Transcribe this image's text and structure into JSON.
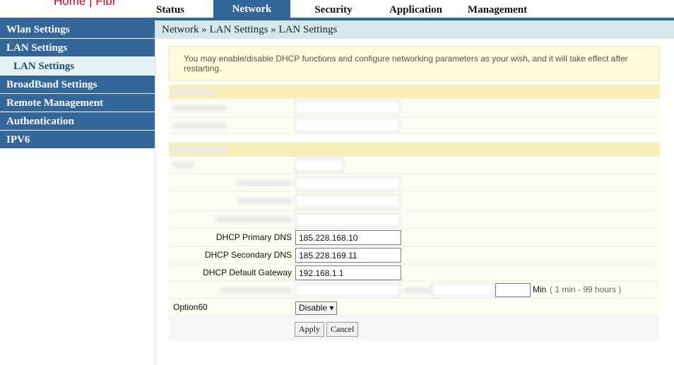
{
  "brand": "Home | Fibr",
  "tabs": [
    {
      "label": "Status"
    },
    {
      "label": "Network"
    },
    {
      "label": "Security"
    },
    {
      "label": "Application"
    },
    {
      "label": "Management"
    }
  ],
  "sidebar": {
    "items": [
      {
        "label": "Wlan Settings"
      },
      {
        "label": "LAN Settings"
      },
      {
        "label": "LAN Settings"
      },
      {
        "label": "BroadBand Settings"
      },
      {
        "label": "Remote Management"
      },
      {
        "label": "Authentication"
      },
      {
        "label": "IPV6"
      }
    ]
  },
  "breadcrumb": "Network » LAN Settings » LAN Settings",
  "info": "You may enable/disable DHCP functions and configure networking parameters as your wish, and it will take effect after restarting.",
  "dhcp": {
    "primary_dns_label": "DHCP Primary DNS",
    "primary_dns": "185.228.168.10",
    "secondary_dns_label": "DHCP Secondary DNS",
    "secondary_dns": "185.228.169.11",
    "gateway_label": "DHCP Default Gateway",
    "gateway": "192.168.1.1",
    "lease_unit": "Min",
    "lease_range": "( 1 min - 99 hours )"
  },
  "option60": {
    "label": "Option60",
    "value": "Disable ▾"
  },
  "buttons": {
    "apply": "Apply",
    "cancel": "Cancel"
  }
}
